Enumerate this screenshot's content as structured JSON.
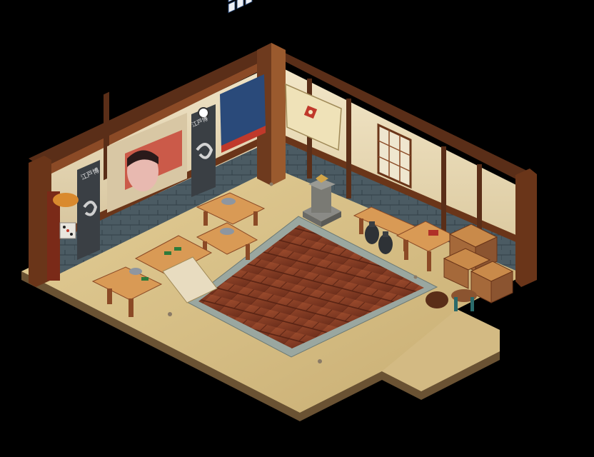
{
  "scene": {
    "type": "isometric-room",
    "theme": "japanese-gambling-den",
    "banner_text_left": "江戸博",
    "banner_text_right": "江戸博"
  },
  "colors": {
    "background": "#000000",
    "floor_sand": "#d9c28e",
    "floor_sand_shadow": "#b89d66",
    "carpet": "#8a4028",
    "carpet_border": "#9aa8a0",
    "wall_paper": "#e8dcc0",
    "wall_stone": "#4a5a62",
    "wood_dark": "#5a2e18",
    "wood_mid": "#8b4a26",
    "wood_light": "#c98a4a",
    "table_top": "#d99a55",
    "banner_dark": "#3a3f44",
    "banner_blue": "#2a4a7a",
    "tile_green": "#2f7a3a",
    "lantern_red": "#c0392b"
  },
  "objects": {
    "tables": 4,
    "benches": 2,
    "crates": 3,
    "vases": 2,
    "stools": 1,
    "pedestal": 1,
    "lantern_stand": 1,
    "kabuki_painting": 1,
    "hanging_banners": 3,
    "mahjong_board": 1,
    "wall_scroll": 1
  }
}
